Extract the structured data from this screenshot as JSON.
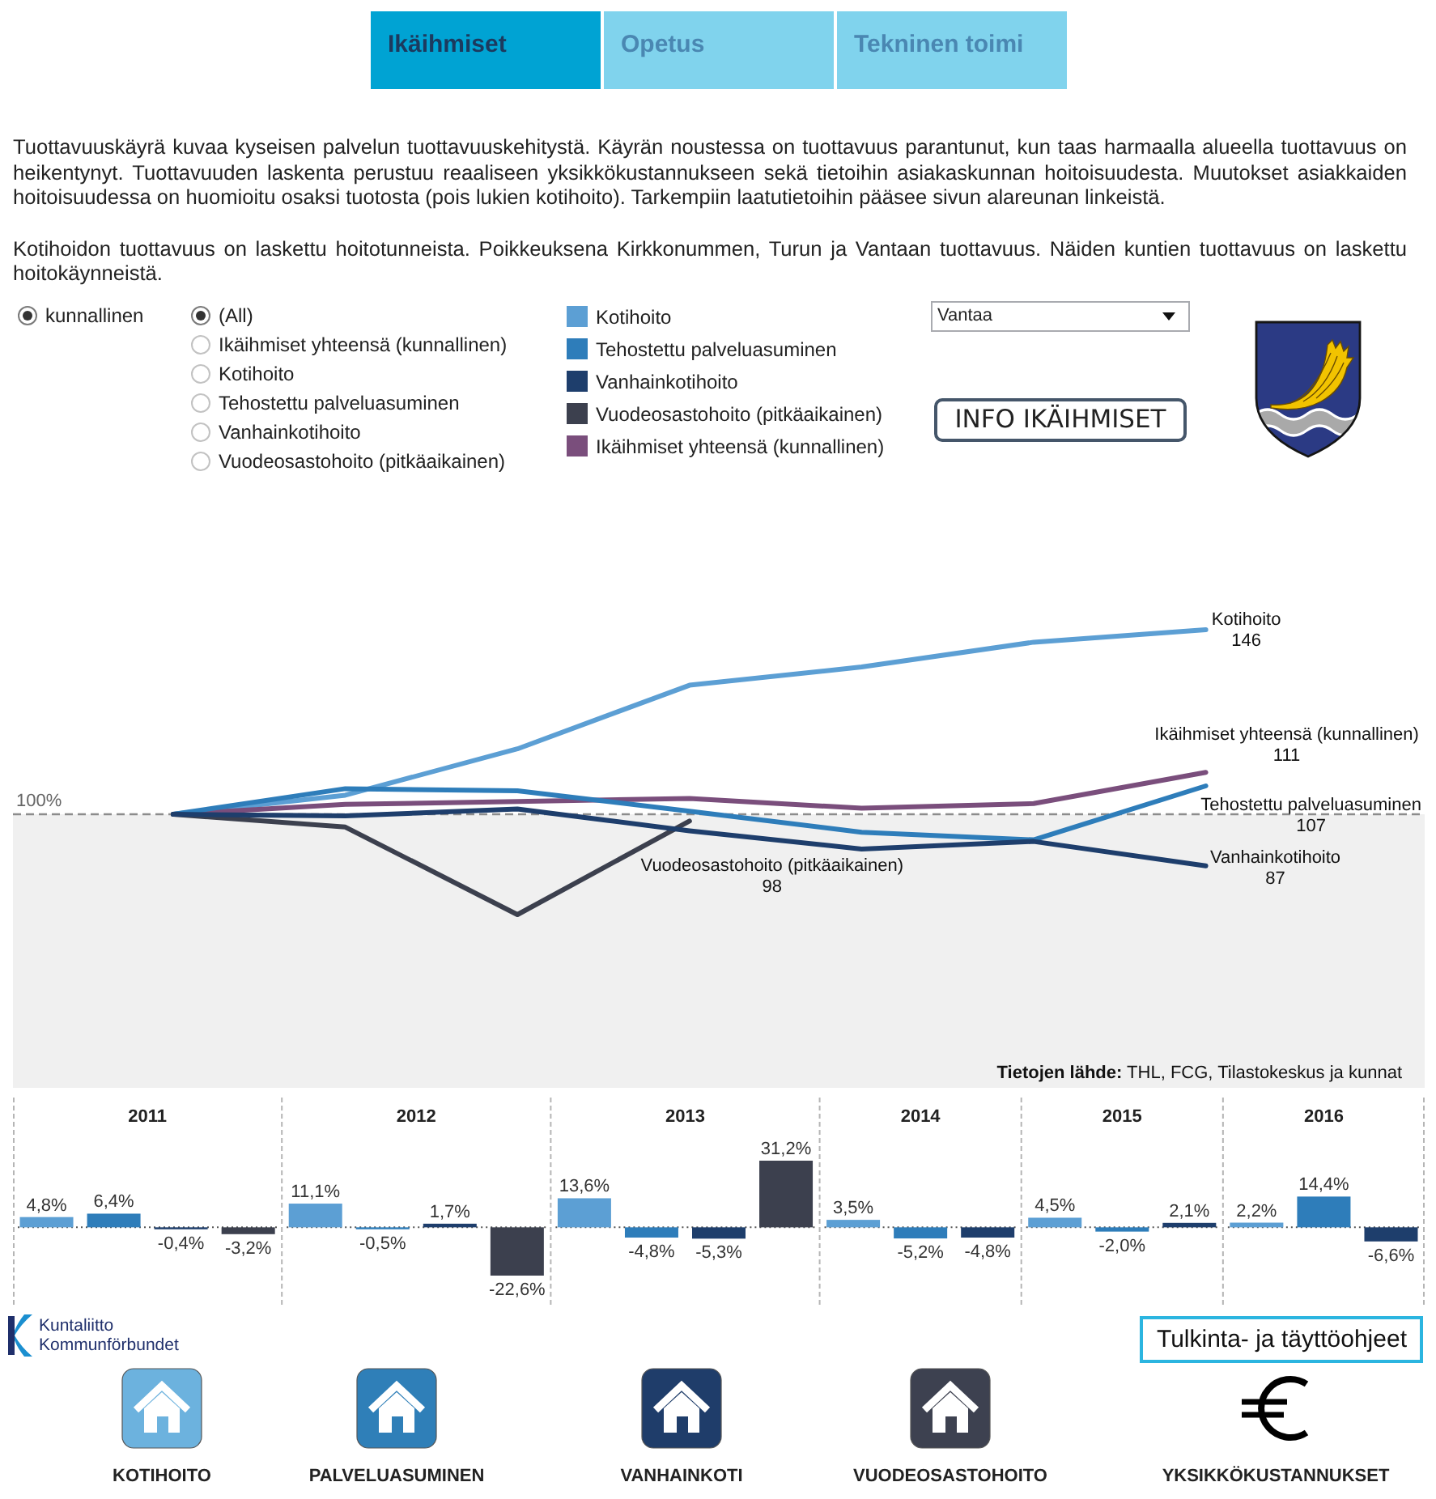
{
  "tabs": [
    {
      "label": "Ikäihmiset",
      "selected": true
    },
    {
      "label": "Opetus",
      "selected": false
    },
    {
      "label": "Tekninen toimi",
      "selected": false
    }
  ],
  "intro": [
    "Tuottavuuskäyrä kuvaa kyseisen palvelun tuottavuuskehitystä. Käyrän noustessa on tuottavuus parantunut, kun taas harmaalla alueella tuottavuus on heikentynyt. Tuottavuuden laskenta perustuu reaaliseen yksikkökustannukseen sekä tietoihin asiakaskunnan hoitoisuudesta. Muutokset asiakkaiden hoitoisuudessa on huomioitu osaksi tuotosta (pois lukien kotihoito). Tarkempiin laatutietoihin pääsee sivun alareunan linkeistä.",
    "Kotihoidon tuottavuus on laskettu hoitotunneista. Poikkeuksena Kirkkonummen, Turun ja Vantaan tuottavuus. Näiden kuntien tuottavuus on laskettu hoitokäynneistä."
  ],
  "filters": {
    "ownership": [
      {
        "label": "kunnallinen",
        "selected": true
      }
    ],
    "services": [
      {
        "label": "(All)",
        "selected": true
      },
      {
        "label": "Ikäihmiset yhteensä (kunnallinen)",
        "selected": false
      },
      {
        "label": "Kotihoito",
        "selected": false
      },
      {
        "label": "Tehostettu palveluasuminen",
        "selected": false
      },
      {
        "label": "Vanhainkotihoito",
        "selected": false
      },
      {
        "label": "Vuodeosastohoito (pitkäaikainen)",
        "selected": false
      }
    ],
    "legend": [
      {
        "label": "Kotihoito",
        "color": "#5c9fd4"
      },
      {
        "label": "Tehostettu palveluasuminen",
        "color": "#2e7dba"
      },
      {
        "label": "Vanhainkotihoito",
        "color": "#1e3e6c"
      },
      {
        "label": "Vuodeosastohoito (pitkäaikainen)",
        "color": "#3c404e"
      },
      {
        "label": "Ikäihmiset yhteensä (kunnallinen)",
        "color": "#7a4e7c"
      }
    ],
    "municipality": {
      "value": "Vantaa"
    },
    "info_button": "INFO IKÄIHMISET"
  },
  "line_chart": {
    "reference_label": "100%",
    "lines": [
      {
        "label": "Kotihoito",
        "value": "146",
        "color": "#5c9fd4"
      },
      {
        "label": "Ikäihmiset yhteensä (kunnallinen)",
        "value": "111",
        "color": "#7a4e7c"
      },
      {
        "label": "Tehostettu palveluasuminen",
        "value": "107",
        "color": "#2e7dba"
      },
      {
        "label": "Vuodeosastohoito (pitkäaikainen)",
        "value": "98",
        "color": "#3c404e"
      },
      {
        "label": "Vanhainkotihoito",
        "value": "87",
        "color": "#1e3e6c"
      }
    ],
    "source": "**Tietojen lähde:** THL, FCG, Tilastokeskus ja kunnat"
  },
  "change_chart": {
    "chart_data": {
      "type": "bar",
      "categories": [
        "2011",
        "2012",
        "2013",
        "2014",
        "2015",
        "2016"
      ],
      "series": [
        {
          "color": "#5c9fd4",
          "values": [
            4.8,
            11.1,
            13.6,
            3.5,
            4.5,
            2.2
          ],
          "value_labels": [
            "4,8%",
            "11,1%",
            "13,6%",
            "3,5%",
            "4,5%",
            "2,2%"
          ]
        },
        {
          "color": "#2e7dba",
          "values": [
            6.4,
            -0.5,
            -4.8,
            -5.2,
            -2.0,
            14.4
          ],
          "value_labels": [
            "6,4%",
            "-0,5%",
            "-4,8%",
            "-5,2%",
            "-2,0%",
            "14,4%"
          ]
        },
        {
          "color": "#1e3e6c",
          "values": [
            -0.4,
            1.7,
            -5.3,
            -4.8,
            2.1,
            -6.6
          ],
          "value_labels": [
            "-0,4%",
            "1,7%",
            "-5,3%",
            "-4,8%",
            "2,1%",
            "-6,6%"
          ]
        },
        {
          "color": "#3c404e",
          "values": [
            -3.2,
            -22.6,
            31.2,
            null,
            null,
            null
          ],
          "value_labels": [
            "-3,2%",
            "-22,6%",
            "31,2%",
            null,
            null,
            null
          ]
        }
      ]
    }
  },
  "footer": {
    "logo": [
      "Kuntaliitto",
      "Kommunförbundet"
    ],
    "guide_button": "Tulkinta- ja täyttöohjeet",
    "links": [
      {
        "label": "KOTIHOITO",
        "kind": "house",
        "color": "#6cb2de"
      },
      {
        "label": "PALVELUASUMINEN",
        "kind": "house",
        "color": "#2f7fb8"
      },
      {
        "label": "VANHAINKOTI",
        "kind": "house",
        "color": "#1f3d6a"
      },
      {
        "label": "VUODEOSASTOHOITO",
        "kind": "house",
        "color": "#3d4150"
      },
      {
        "label": "YKSIKKÖKUSTANNUKSET",
        "kind": "euro"
      }
    ]
  }
}
